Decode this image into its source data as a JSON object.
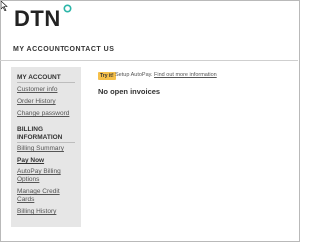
{
  "brand": {
    "logo_text": "DTN"
  },
  "topnav": {
    "my_account": "MY ACCOUNT",
    "contact_us": "CONTACT US"
  },
  "sidebar": {
    "section1_title": "MY ACCOUNT",
    "customer_info": "Customer info",
    "order_history": "Order History",
    "change_password": "Change password",
    "section2_title": "BILLING INFORMATION",
    "billing_summary": "Billing Summary",
    "pay_now": "Pay Now",
    "autopay_options": "AutoPay Billing Options",
    "manage_cards": "Manage Credit Cards",
    "billing_history": "Billing History"
  },
  "main": {
    "try_badge": "Try it!",
    "autopay_prompt": "Setup AutoPay.",
    "autopay_link": "Find out more information",
    "status": "No open invoices"
  }
}
